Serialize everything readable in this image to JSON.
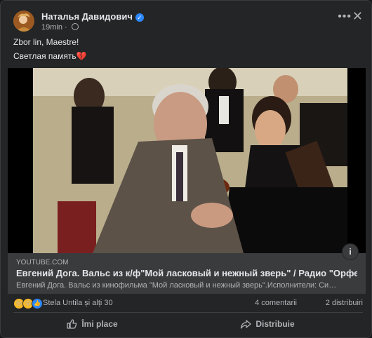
{
  "post": {
    "author": "Наталья Давидович",
    "time": "19min",
    "separator": "·",
    "menu_icon": "more-horizontal-icon",
    "close_icon": "close-icon",
    "text_line1": "Zbor lin, Maestre!",
    "text_line2": "Светлая память",
    "heart_emoji": "💔"
  },
  "link": {
    "domain": "YOUTUBE.COM",
    "title": "Евгений Дога. Вальс из к/ф\"Мой ласковый и нежный зверь\" / Радио \"Орфей\"",
    "description": "Евгений Дога. Вальс из кинофильма \"Мой ласковый и нежный зверь\".Исполнители: Симф…"
  },
  "reactions": {
    "summary": "Stela Untila și alți 30",
    "comments": "4 comentarii",
    "shares": "2 distribuiri"
  },
  "actions": {
    "like": "Îmi place",
    "share": "Distribuie"
  },
  "colors": {
    "card_bg": "#242526",
    "accent": "#2d88ff",
    "secondary_text": "#b0b3b8"
  }
}
